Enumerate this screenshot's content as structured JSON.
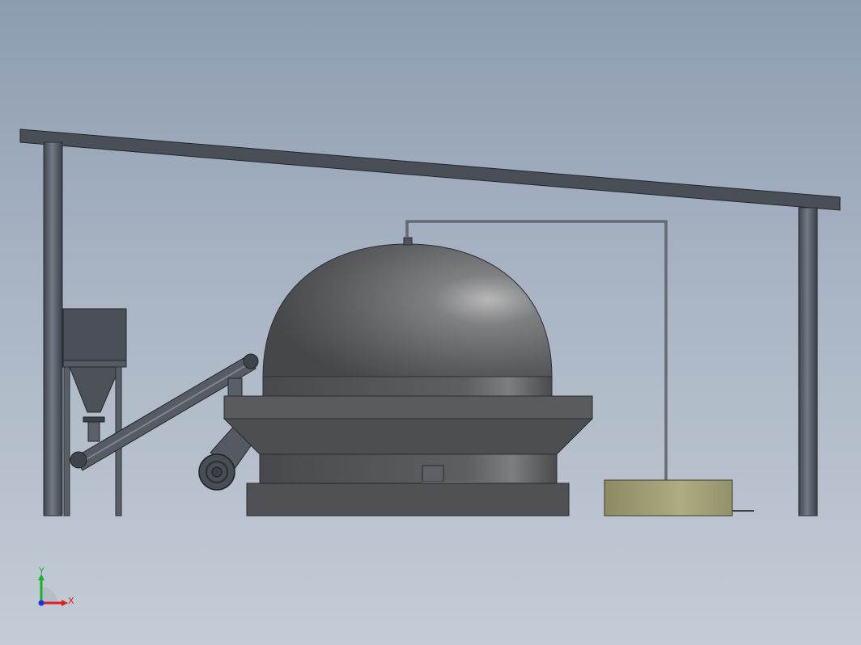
{
  "triad": {
    "x_label": "X",
    "y_label": "Y",
    "x_color": "#e0201c",
    "y_color": "#19b22a",
    "z_color": "#1b2ee0"
  },
  "colors": {
    "background_top": "#8d9cb0",
    "background_bottom": "#c4ccd6",
    "steel": "#4d535c",
    "dome": "#5e5f62",
    "tank": "#a9a87c"
  }
}
